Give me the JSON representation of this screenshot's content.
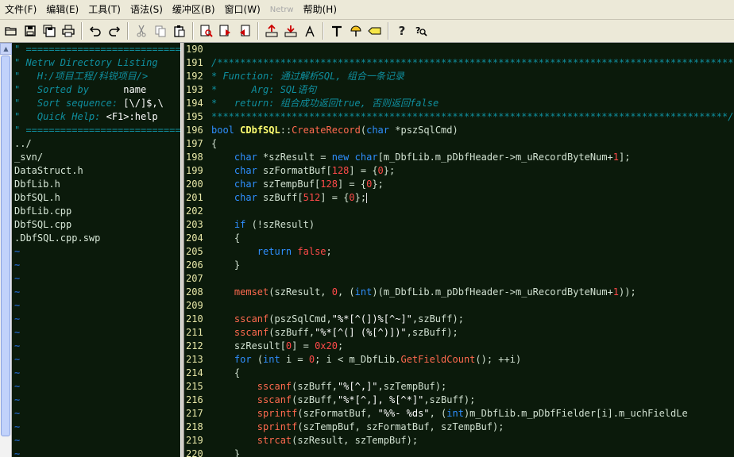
{
  "menu": [
    "文件(F)",
    "编辑(E)",
    "工具(T)",
    "语法(S)",
    "缓冲区(B)",
    "窗口(W)",
    "Netrw",
    "帮助(H)"
  ],
  "toolbar": {
    "icons": [
      "open-file-icon",
      "save-icon",
      "save-all-icon",
      "print-icon",
      "undo-icon",
      "redo-icon",
      "cut-icon",
      "copy-icon",
      "paste-icon",
      "find-icon",
      "find-next-icon",
      "find-prev-icon",
      "load-session-icon",
      "save-session-icon",
      "run-script-icon",
      "make-icon",
      "shell-icon",
      "tag-jump-icon",
      "help-icon",
      "find-help-icon"
    ]
  },
  "netrw": {
    "lines": [
      {
        "cls": "cmt",
        "text": "\" ============================================================================"
      },
      {
        "cls": "cmt",
        "text": "\" Netrw Directory Listing"
      },
      {
        "cls": "hdr",
        "text": "\"   H:/项目工程/科锐项目/>"
      },
      {
        "cls": "hdr2",
        "label": "\"   Sorted by      ",
        "value": "name"
      },
      {
        "cls": "hdr2",
        "label": "\"   Sort sequence: ",
        "value": "[\\/]$,\\"
      },
      {
        "cls": "hdr2",
        "label": "\"   Quick Help: ",
        "value": "<F1>:help"
      },
      {
        "cls": "cmt",
        "text": "\" ============================================================================"
      },
      {
        "cls": "dir",
        "text": "../"
      },
      {
        "cls": "dir",
        "text": "_svn/"
      },
      {
        "cls": "file",
        "text": "DataStruct.h"
      },
      {
        "cls": "file",
        "text": "DbfLib.h"
      },
      {
        "cls": "file",
        "text": "DbfSQL.h"
      },
      {
        "cls": "file",
        "text": "DbfLib.cpp"
      },
      {
        "cls": "file",
        "text": "DbfSQL.cpp"
      },
      {
        "cls": "file",
        "text": ".DbfSQL.cpp.swp"
      }
    ],
    "tilde_count": 16
  },
  "code": [
    {
      "n": "190",
      "segs": []
    },
    {
      "n": "191",
      "segs": [
        [
          "c",
          "/******************************************************************************************"
        ]
      ]
    },
    {
      "n": "192",
      "segs": [
        [
          "c",
          "* Function: 通过解析SQL, 组合一条记录"
        ]
      ]
    },
    {
      "n": "193",
      "segs": [
        [
          "c",
          "*      Arg: SQL语句"
        ]
      ]
    },
    {
      "n": "194",
      "segs": [
        [
          "c",
          "*   return: 组合成功返回true, 否则返回false"
        ]
      ]
    },
    {
      "n": "195",
      "segs": [
        [
          "c",
          "******************************************************************************************/"
        ]
      ]
    },
    {
      "n": "196",
      "segs": [
        [
          "t",
          "bool"
        ],
        [
          "p",
          " "
        ],
        [
          "y",
          "CDbfSQL"
        ],
        [
          "p",
          "::"
        ],
        [
          "f",
          "CreateRecord"
        ],
        [
          "p",
          "("
        ],
        [
          "t",
          "char"
        ],
        [
          "p",
          " *pszSqlCmd)"
        ]
      ]
    },
    {
      "n": "197",
      "segs": [
        [
          "p",
          "{"
        ]
      ]
    },
    {
      "n": "198",
      "segs": [
        [
          "p",
          "    "
        ],
        [
          "t",
          "char"
        ],
        [
          "p",
          " *szResult = "
        ],
        [
          "t",
          "new"
        ],
        [
          "p",
          " "
        ],
        [
          "t",
          "char"
        ],
        [
          "p",
          "[m_DbfLib.m_pDbfHeader->m_uRecordByteNum+"
        ],
        [
          "n",
          "1"
        ],
        [
          "p",
          "];"
        ]
      ]
    },
    {
      "n": "199",
      "segs": [
        [
          "p",
          "    "
        ],
        [
          "t",
          "char"
        ],
        [
          "p",
          " szFormatBuf["
        ],
        [
          "n",
          "128"
        ],
        [
          "p",
          "] = {"
        ],
        [
          "n",
          "0"
        ],
        [
          "p",
          "};"
        ]
      ]
    },
    {
      "n": "200",
      "segs": [
        [
          "p",
          "    "
        ],
        [
          "t",
          "char"
        ],
        [
          "p",
          " szTempBuf["
        ],
        [
          "n",
          "128"
        ],
        [
          "p",
          "] = {"
        ],
        [
          "n",
          "0"
        ],
        [
          "p",
          "};"
        ]
      ]
    },
    {
      "n": "201",
      "segs": [
        [
          "p",
          "    "
        ],
        [
          "t",
          "char"
        ],
        [
          "p",
          " szBuff["
        ],
        [
          "n",
          "512"
        ],
        [
          "p",
          "] = {"
        ],
        [
          "n",
          "0"
        ],
        [
          "p",
          "};"
        ],
        [
          "cursor",
          ""
        ]
      ]
    },
    {
      "n": "202",
      "segs": []
    },
    {
      "n": "203",
      "segs": [
        [
          "p",
          "    "
        ],
        [
          "t",
          "if"
        ],
        [
          "p",
          " (!szResult)"
        ]
      ]
    },
    {
      "n": "204",
      "segs": [
        [
          "p",
          "    {"
        ]
      ]
    },
    {
      "n": "205",
      "segs": [
        [
          "p",
          "        "
        ],
        [
          "t",
          "return"
        ],
        [
          "p",
          " "
        ],
        [
          "n",
          "false"
        ],
        [
          "p",
          ";"
        ]
      ]
    },
    {
      "n": "206",
      "segs": [
        [
          "p",
          "    }"
        ]
      ]
    },
    {
      "n": "207",
      "segs": []
    },
    {
      "n": "208",
      "segs": [
        [
          "p",
          "    "
        ],
        [
          "f",
          "memset"
        ],
        [
          "p",
          "(szResult, "
        ],
        [
          "n",
          "0"
        ],
        [
          "p",
          ", ("
        ],
        [
          "t",
          "int"
        ],
        [
          "p",
          ")(m_DbfLib.m_pDbfHeader->m_uRecordByteNum+"
        ],
        [
          "n",
          "1"
        ],
        [
          "p",
          "));"
        ]
      ]
    },
    {
      "n": "209",
      "segs": []
    },
    {
      "n": "210",
      "segs": [
        [
          "p",
          "    "
        ],
        [
          "f",
          "sscanf"
        ],
        [
          "p",
          "(pszSqlCmd,"
        ],
        [
          "s",
          "\"%*[^(])%[^~]\""
        ],
        [
          "p",
          ",szBuff);"
        ]
      ]
    },
    {
      "n": "211",
      "segs": [
        [
          "p",
          "    "
        ],
        [
          "f",
          "sscanf"
        ],
        [
          "p",
          "(szBuff,"
        ],
        [
          "s",
          "\"%*[^(] (%[^)])\""
        ],
        [
          "p",
          ",szBuff);"
        ]
      ]
    },
    {
      "n": "212",
      "segs": [
        [
          "p",
          "    szResult["
        ],
        [
          "n",
          "0"
        ],
        [
          "p",
          "] = "
        ],
        [
          "n",
          "0x20"
        ],
        [
          "p",
          ";"
        ]
      ]
    },
    {
      "n": "213",
      "segs": [
        [
          "p",
          "    "
        ],
        [
          "t",
          "for"
        ],
        [
          "p",
          " ("
        ],
        [
          "t",
          "int"
        ],
        [
          "p",
          " i = "
        ],
        [
          "n",
          "0"
        ],
        [
          "p",
          "; i < m_DbfLib."
        ],
        [
          "f",
          "GetFieldCount"
        ],
        [
          "p",
          "(); ++i)"
        ]
      ]
    },
    {
      "n": "214",
      "segs": [
        [
          "p",
          "    {"
        ]
      ]
    },
    {
      "n": "215",
      "segs": [
        [
          "p",
          "        "
        ],
        [
          "f",
          "sscanf"
        ],
        [
          "p",
          "(szBuff,"
        ],
        [
          "s",
          "\"%[^,]\""
        ],
        [
          "p",
          ",szTempBuf);"
        ]
      ]
    },
    {
      "n": "216",
      "segs": [
        [
          "p",
          "        "
        ],
        [
          "f",
          "sscanf"
        ],
        [
          "p",
          "(szBuff,"
        ],
        [
          "s",
          "\"%*[^,], %[^*]\""
        ],
        [
          "p",
          ",szBuff);"
        ]
      ]
    },
    {
      "n": "217",
      "segs": [
        [
          "p",
          "        "
        ],
        [
          "f",
          "sprintf"
        ],
        [
          "p",
          "(szFormatBuf, "
        ],
        [
          "s",
          "\"%%- %ds\""
        ],
        [
          "p",
          ", ("
        ],
        [
          "t",
          "int"
        ],
        [
          "p",
          ")m_DbfLib.m_pDbfFielder[i].m_uchFieldLe"
        ]
      ]
    },
    {
      "n": "218",
      "segs": [
        [
          "p",
          "        "
        ],
        [
          "f",
          "sprintf"
        ],
        [
          "p",
          "(szTempBuf, szFormatBuf, szTempBuf);"
        ]
      ]
    },
    {
      "n": "219",
      "segs": [
        [
          "p",
          "        "
        ],
        [
          "f",
          "strcat"
        ],
        [
          "p",
          "(szResult, szTempBuf);"
        ]
      ]
    },
    {
      "n": "220",
      "segs": [
        [
          "p",
          "    }"
        ]
      ]
    }
  ],
  "colors": {
    "background": "#0b1a0b",
    "line_number": "#e8e8a8",
    "comment": "#0f8f9f",
    "type": "#2f8fff",
    "class": "#ffff70",
    "function": "#ff6a4f",
    "number": "#ff4a4a",
    "string": "#ffffff",
    "plain": "#d0e0d0",
    "tilde": "#1e5cb3",
    "netrw_value": "#ffffff"
  }
}
